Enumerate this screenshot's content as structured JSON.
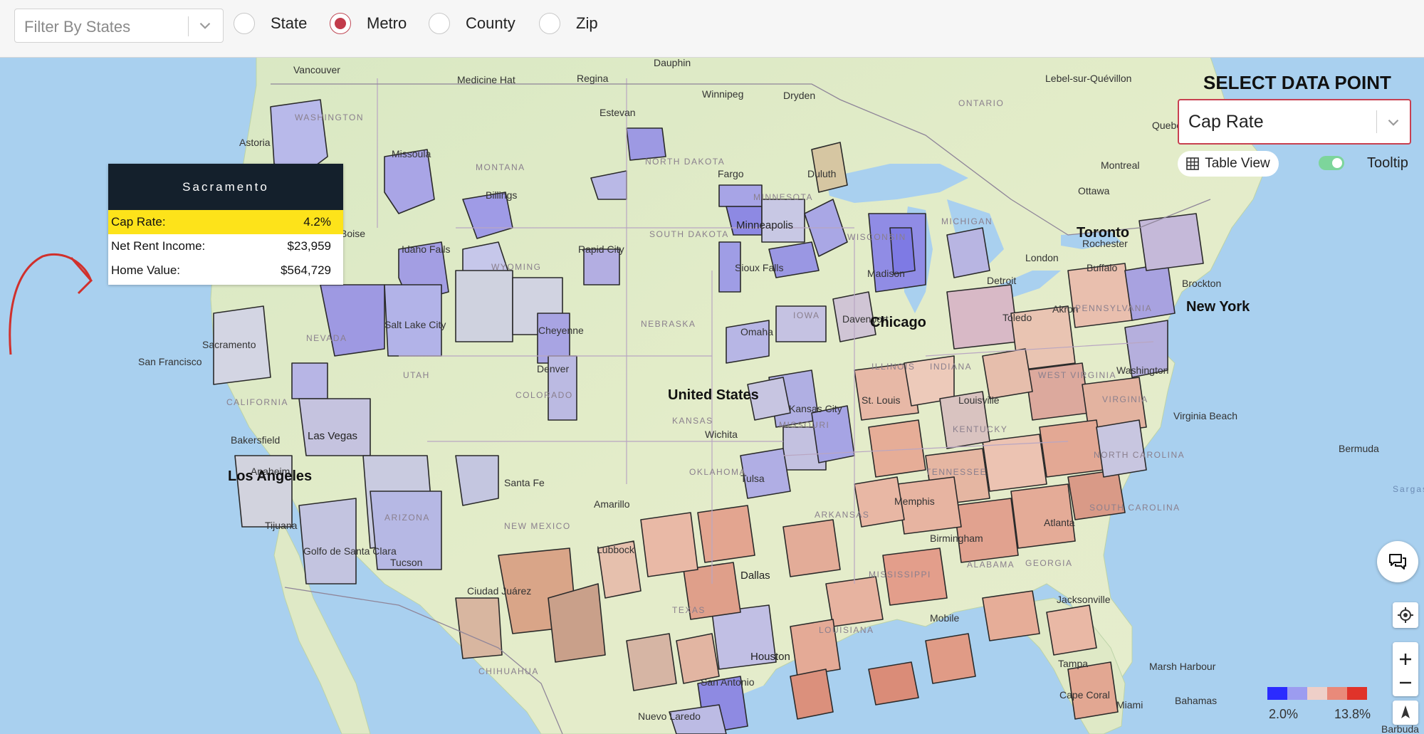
{
  "toolbar": {
    "filter_placeholder": "Filter By States",
    "geo_levels": [
      {
        "label": "State",
        "selected": false
      },
      {
        "label": "Metro",
        "selected": true
      },
      {
        "label": "County",
        "selected": false
      },
      {
        "label": "Zip",
        "selected": false
      }
    ]
  },
  "data_point": {
    "title": "SELECT DATA POINT",
    "selected": "Cap Rate",
    "table_view_label": "Table View",
    "tooltip_label": "Tooltip",
    "tooltip_enabled": true
  },
  "tooltip": {
    "title": "Sacramento",
    "rows": [
      {
        "label": "Cap Rate:",
        "value": "4.2%"
      },
      {
        "label": "Net Rent Income:",
        "value": "$23,959"
      },
      {
        "label": "Home Value:",
        "value": "$564,729"
      }
    ]
  },
  "legend": {
    "min_label": "2.0%",
    "max_label": "13.8%",
    "colors": [
      "#2b2bff",
      "#9c9cf0",
      "#eecfc8",
      "#e98a7a",
      "#e0332a"
    ]
  },
  "map_labels": {
    "countries": [
      "United States"
    ],
    "cities_major": [
      "Chicago",
      "New York",
      "Los Angeles",
      "Toronto"
    ],
    "cities": [
      "Vancouver",
      "Medicine Hat",
      "Regina",
      "Dauphin",
      "Winnipeg",
      "Dryden",
      "Lebel-sur-Quévillon",
      "Estevan",
      "Astoria",
      "Missoula",
      "Billings",
      "Fargo",
      "Duluth",
      "Quebec",
      "Montreal",
      "Ottawa",
      "Boise",
      "Idaho Falls",
      "Rapid City",
      "Minneapolis",
      "Sioux Falls",
      "Madison",
      "Detroit",
      "London",
      "Rochester",
      "Buffalo",
      "Brockton",
      "Salt Lake City",
      "Cheyenne",
      "Omaha",
      "Davenport",
      "Toledo",
      "Akron",
      "Sacramento",
      "San Francisco",
      "Denver",
      "Kansas City",
      "St. Louis",
      "Louisville",
      "Washington",
      "Virginia Beach",
      "Bakersfield",
      "Las Vegas",
      "Wichita",
      "Tulsa",
      "Memphis",
      "Anaheim",
      "Santa Fe",
      "Amarillo",
      "Birmingham",
      "Atlanta",
      "Tijuana",
      "Golfo de Santa Clara",
      "Tucson",
      "Lubbock",
      "Dallas",
      "Ciudad Juárez",
      "Mobile",
      "Jacksonville",
      "Houston",
      "San Antonio",
      "Tampa",
      "Nuevo Laredo",
      "Cape Coral",
      "Miami",
      "Marsh Harbour",
      "Bahamas",
      "Bermuda",
      "Barbuda"
    ],
    "states": [
      "WASHINGTON",
      "MONTANA",
      "NORTH DAKOTA",
      "MINNESOTA",
      "MICHIGAN",
      "SOUTH DAKOTA",
      "WISCONSIN",
      "WYOMING",
      "NEBRASKA",
      "IOWA",
      "NEVADA",
      "UTAH",
      "COLORADO",
      "ILLINOIS",
      "INDIANA",
      "KANSAS",
      "MISSOURI",
      "KENTUCKY",
      "WEST VIRGINIA",
      "VIRGINIA",
      "CALIFORNIA",
      "OKLAHOMA",
      "ARKANSAS",
      "TENNESSEE",
      "NORTH CAROLINA",
      "SOUTH CAROLINA",
      "ARIZONA",
      "NEW MEXICO",
      "TEXAS",
      "MISSISSIPPI",
      "ALABAMA",
      "GEORGIA",
      "LOUISIANA",
      "PENNSYLVANIA",
      "CHIHUAHUA",
      "ONTARIO"
    ],
    "waters": [
      "Sargasso Sea"
    ]
  }
}
